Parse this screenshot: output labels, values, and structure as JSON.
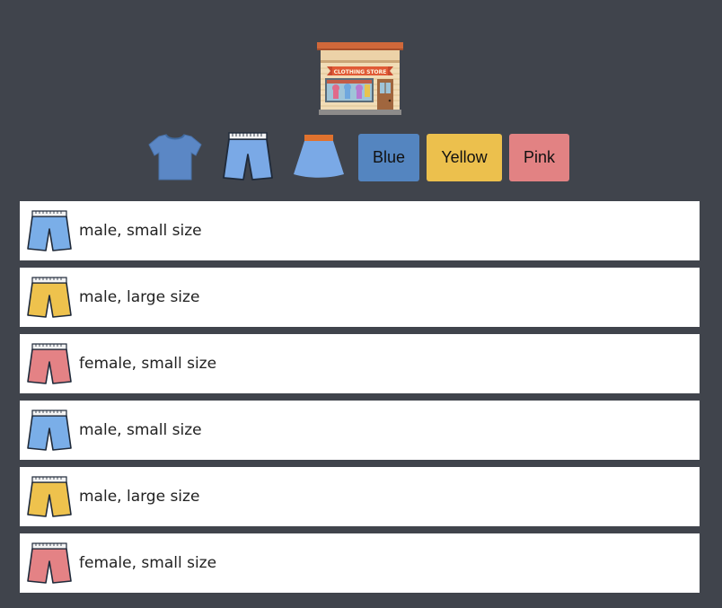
{
  "store": {
    "logo_name": "clothing-store-icon",
    "sign_text": "CLOTHING STORE"
  },
  "filters": {
    "types": [
      {
        "name": "shirt-icon",
        "color": "#5b87c5"
      },
      {
        "name": "shorts-icon",
        "color": "#7aa9e6"
      },
      {
        "name": "skirt-icon",
        "color": "#7aa9e6"
      }
    ],
    "colors": [
      {
        "label": "Blue",
        "color": "#5485c0"
      },
      {
        "label": "Yellow",
        "color": "#ecc04d"
      },
      {
        "label": "Pink",
        "color": "#e28283"
      }
    ]
  },
  "items": [
    {
      "text": "male, small size",
      "icon": "shorts-icon",
      "color": "#7aaee8"
    },
    {
      "text": "male, large size",
      "icon": "shorts-icon",
      "color": "#eec24d"
    },
    {
      "text": "female, small size",
      "icon": "shorts-icon",
      "color": "#e48285"
    },
    {
      "text": "male, small size",
      "icon": "shorts-icon",
      "color": "#7aaee8"
    },
    {
      "text": "male, large size",
      "icon": "shorts-icon",
      "color": "#eec24d"
    },
    {
      "text": "female, small size",
      "icon": "shorts-icon",
      "color": "#e48285"
    }
  ]
}
